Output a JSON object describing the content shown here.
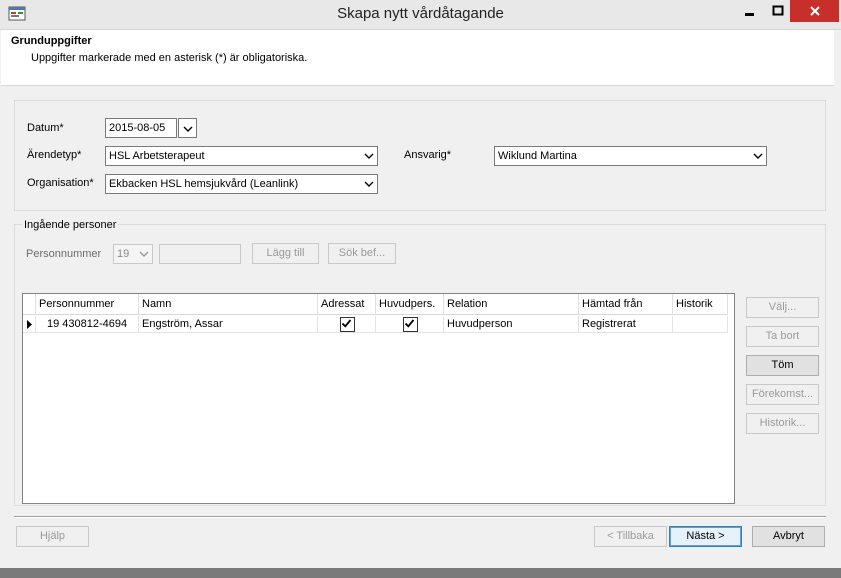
{
  "window": {
    "title": "Skapa nytt vårdåtagande"
  },
  "header": {
    "heading": "Grunduppgifter",
    "description": "Uppgifter markerade med en asterisk (*) är obligatoriska."
  },
  "form": {
    "datum_label": "Datum*",
    "datum_value": "2015-08-05",
    "arendetyp_label": "Ärendetyp*",
    "arendetyp_value": "HSL Arbetsterapeut",
    "ansvarig_label": "Ansvarig*",
    "ansvarig_value": "Wiklund Martina",
    "organisation_label": "Organisation*",
    "organisation_value": "Ekbacken HSL hemsjukvård (Leanlink)"
  },
  "persons": {
    "group_label": "Ingående personer",
    "personnummer_label": "Personnummer",
    "century_value": "19",
    "add_button": "Lägg till",
    "search_button": "Sök bef...",
    "grid": {
      "columns": [
        "Personnummer",
        "Namn",
        "Adressat",
        "Huvudpers.",
        "Relation",
        "Hämtad från",
        "Historik"
      ],
      "rows": [
        {
          "personnummer": "19 430812-4694",
          "namn": "Engström, Assar",
          "adressat": true,
          "huvudpers": true,
          "relation": "Huvudperson",
          "hamtad_fran": "Registrerat",
          "historik": ""
        }
      ]
    },
    "side_buttons": {
      "valj": "Välj...",
      "ta_bort": "Ta bort",
      "tom": "Töm",
      "forekomst": "Förekomst...",
      "historik": "Historik..."
    }
  },
  "footer": {
    "help": "Hjälp",
    "back": "< Tillbaka",
    "next": "Nästa >",
    "cancel": "Avbryt"
  },
  "colors": {
    "close_button": "#c7302a",
    "default_button_border": "#3c7fb1"
  }
}
